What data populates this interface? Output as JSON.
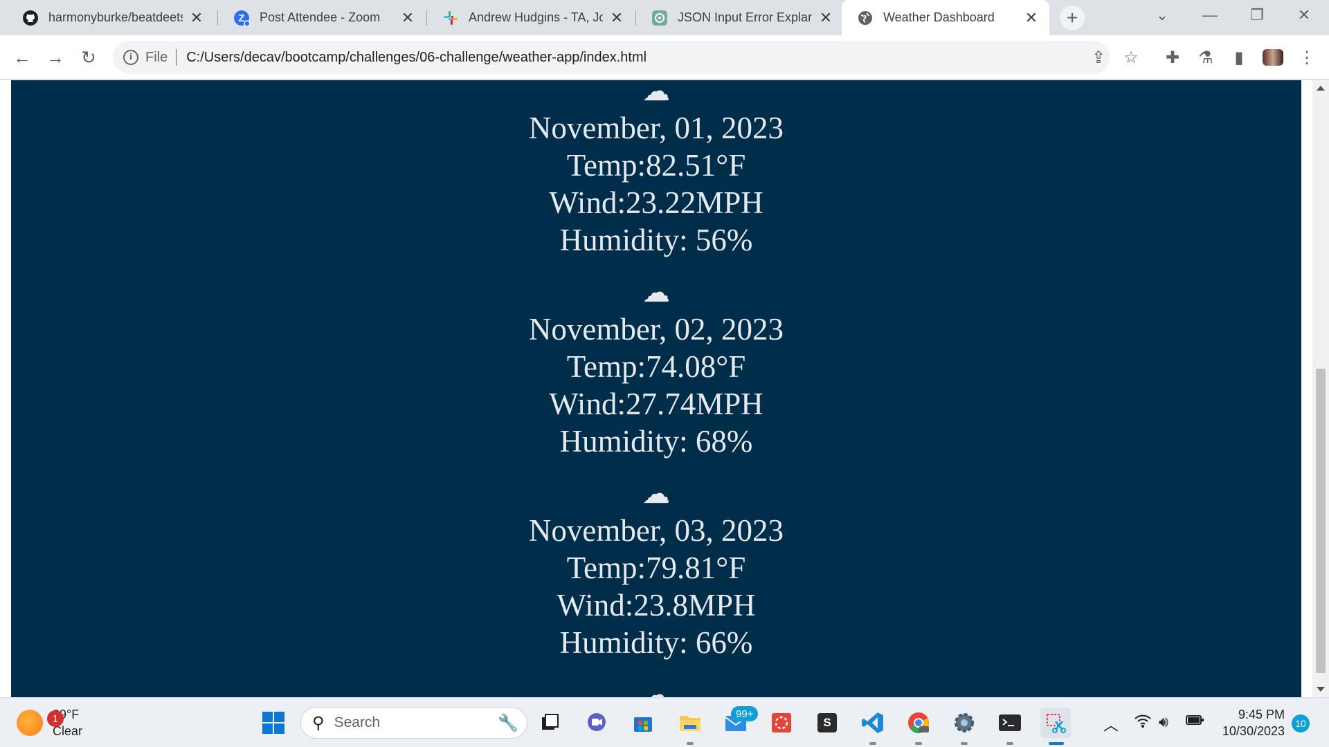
{
  "tabs": [
    {
      "title": "harmonyburke/beatdeets",
      "icon": "github-icon"
    },
    {
      "title": "Post Attendee - Zoom",
      "icon": "zoom-icon"
    },
    {
      "title": "Andrew Hudgins - TA, Jo",
      "icon": "slack-icon"
    },
    {
      "title": "JSON Input Error Explana",
      "icon": "chatgpt-icon"
    },
    {
      "title": "Weather Dashboard",
      "icon": "globe-icon",
      "active": true
    }
  ],
  "addressbar": {
    "scheme_label": "File",
    "url": "C:/Users/decav/bootcamp/challenges/06-challenge/weather-app/index.html"
  },
  "forecast": [
    {
      "icon": "☁",
      "date": "November, 01, 2023",
      "temp": "Temp:82.51°F",
      "wind": "Wind:23.22MPH",
      "humidity": "Humidity: 56%"
    },
    {
      "icon": "☁",
      "date": "November, 02, 2023",
      "temp": "Temp:74.08°F",
      "wind": "Wind:27.74MPH",
      "humidity": "Humidity: 68%"
    },
    {
      "icon": "☁",
      "date": "November, 03, 2023",
      "temp": "Temp:79.81°F",
      "wind": "Wind:23.8MPH",
      "humidity": "Humidity: 66%"
    }
  ],
  "taskbar": {
    "weather": {
      "temp": "29°F",
      "condition": "Clear",
      "badge": "1"
    },
    "search_label": "Search",
    "mail_badge": "99+",
    "store_letter": "S",
    "clock": {
      "time": "9:45 PM",
      "date": "10/30/2023"
    },
    "notifications": "10"
  },
  "colors": {
    "page_background": "#002d4a",
    "page_text": "#e6eaee",
    "accent": "#0f9fd8"
  }
}
